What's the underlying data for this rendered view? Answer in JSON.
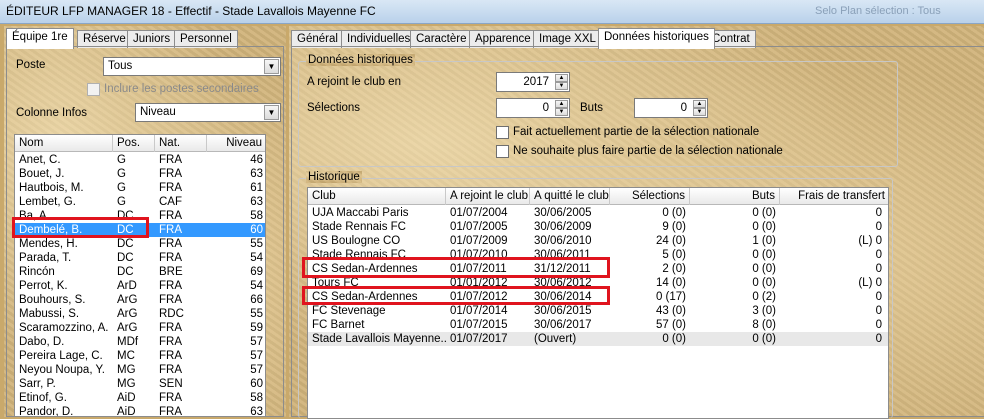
{
  "window": {
    "title": "ÉDITEUR LFP MANAGER 18 - Effectif - Stade Lavallois Mayenne FC",
    "faded_text": "Selo Plan sélection : Tous"
  },
  "left": {
    "tabs": [
      "Équipe 1re",
      "Réserve",
      "Juniors",
      "Personnel"
    ],
    "poste_label": "Poste",
    "poste_value": "Tous",
    "inclure_label": "Inclure les postes secondaires",
    "colonne_label": "Colonne Infos",
    "colonne_value": "Niveau",
    "columns": [
      "Nom",
      "Pos.",
      "Nat.",
      "Niveau"
    ],
    "players": [
      [
        "Anet, C.",
        "G",
        "FRA",
        "46"
      ],
      [
        "Bouet, J.",
        "G",
        "FRA",
        "63"
      ],
      [
        "Hautbois, M.",
        "G",
        "FRA",
        "61"
      ],
      [
        "Lembet, G.",
        "G",
        "CAF",
        "63"
      ],
      [
        "Ba, A.",
        "DC",
        "FRA",
        "58"
      ],
      [
        "Dembelé, B.",
        "DC",
        "FRA",
        "60"
      ],
      [
        "Mendes, H.",
        "DC",
        "FRA",
        "55"
      ],
      [
        "Parada, T.",
        "DC",
        "FRA",
        "54"
      ],
      [
        "Rincón",
        "DC",
        "BRE",
        "69"
      ],
      [
        "Perrot, K.",
        "ArD",
        "FRA",
        "54"
      ],
      [
        "Bouhours, S.",
        "ArG",
        "FRA",
        "66"
      ],
      [
        "Mabussi, S.",
        "ArG",
        "RDC",
        "55"
      ],
      [
        "Scaramozzino, A.",
        "ArG",
        "FRA",
        "59"
      ],
      [
        "Dabo, D.",
        "MDf",
        "FRA",
        "57"
      ],
      [
        "Pereira Lage, C.",
        "MC",
        "FRA",
        "57"
      ],
      [
        "Neyou Noupa, Y.",
        "MG",
        "FRA",
        "57"
      ],
      [
        "Sarr, P.",
        "MG",
        "SEN",
        "60"
      ],
      [
        "Etinof, G.",
        "AiD",
        "FRA",
        "58"
      ],
      [
        "Pandor, D.",
        "AiD",
        "FRA",
        "63"
      ]
    ]
  },
  "right": {
    "tabs": [
      "Général",
      "Individuelles",
      "Caractère",
      "Apparence",
      "Image XXL",
      "Données historiques",
      "Contrat"
    ],
    "donnees": {
      "title": "Données historiques",
      "rejoint_label": "A rejoint le club en",
      "rejoint_value": "2017",
      "selections_label": "Sélections",
      "selections_value": "0",
      "buts_label": "Buts",
      "buts_value": "0",
      "chk1_label": "Fait actuellement partie de la sélection nationale",
      "chk2_label": "Ne souhaite plus faire partie de la sélection nationale"
    },
    "historique": {
      "title": "Historique",
      "columns": [
        "Club",
        "A rejoint le club",
        "A quitté le club",
        "Sélections",
        "Buts",
        "Frais de transfert"
      ],
      "rows": [
        [
          "UJA Maccabi Paris",
          "01/07/2004",
          "30/06/2005",
          "0 (0)",
          "0 (0)",
          "0"
        ],
        [
          "Stade Rennais FC",
          "01/07/2005",
          "30/06/2009",
          "9 (0)",
          "0 (0)",
          "0"
        ],
        [
          "US Boulogne CO",
          "01/07/2009",
          "30/06/2010",
          "24 (0)",
          "1 (0)",
          "(L) 0"
        ],
        [
          "Stade Rennais FC",
          "01/07/2010",
          "30/06/2011",
          "5 (0)",
          "0 (0)",
          "0"
        ],
        [
          "CS Sedan-Ardennes",
          "01/07/2011",
          "31/12/2011",
          "2 (0)",
          "0 (0)",
          "0"
        ],
        [
          "Tours FC",
          "01/01/2012",
          "30/06/2012",
          "14 (0)",
          "0 (0)",
          "(L) 0"
        ],
        [
          "CS Sedan-Ardennes",
          "01/07/2012",
          "30/06/2014",
          "0 (17)",
          "0 (2)",
          "0"
        ],
        [
          "FC Stevenage",
          "01/07/2014",
          "30/06/2015",
          "43 (0)",
          "3 (0)",
          "0"
        ],
        [
          "FC Barnet",
          "01/07/2015",
          "30/06/2017",
          "57 (0)",
          "8 (0)",
          "0"
        ],
        [
          "Stade Lavallois Mayenne...",
          "01/07/2017",
          "(Ouvert)",
          "0 (0)",
          "0 (0)",
          "0"
        ]
      ]
    }
  },
  "colors": {
    "highlight": "#e0141e",
    "selection": "#3399ff",
    "background": "#d1b47b"
  }
}
